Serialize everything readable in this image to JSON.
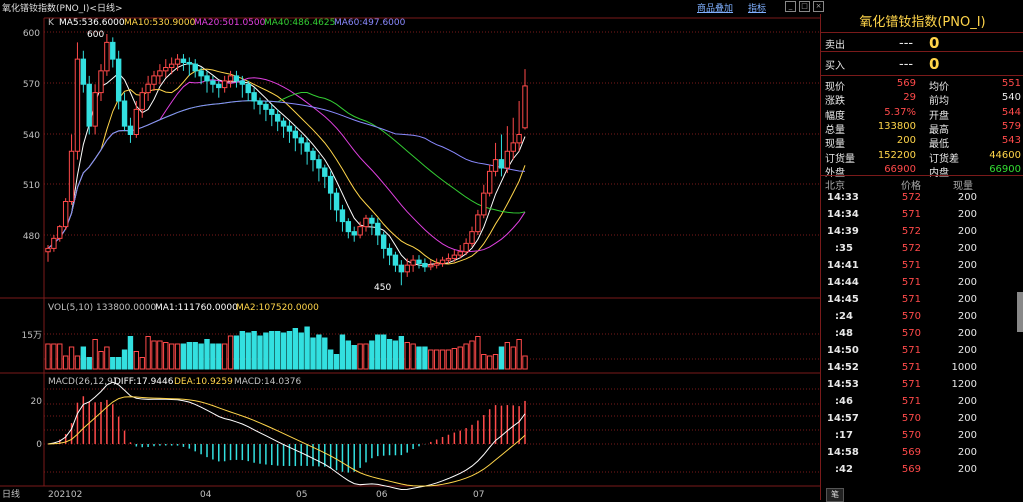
{
  "window": {
    "title": "氧化镨钕指数(PNO_I)<日线>",
    "link1": "商品叠加",
    "link2": "指标"
  },
  "kline": {
    "prefix": "K",
    "ma5": "MA5:536.6000",
    "ma10": "MA10:530.9000",
    "ma20": "MA20:501.0500",
    "ma40": "MA40:486.4625",
    "ma60": "MA60:497.6000",
    "yticks": [
      "600",
      "570",
      "540",
      "510",
      "480"
    ],
    "high_label": "600",
    "low_label": "450"
  },
  "vol": {
    "header": "VOL(5,10) 133800.0000",
    "ma1": "MA1:111760.0000",
    "ma2": "MA2:107520.0000",
    "ytick": "15万"
  },
  "macd": {
    "header": "MACD(26,12,9)",
    "diff": "DIFF:17.9446",
    "dea": "DEA:10.9259",
    "macd": "MACD:14.0376",
    "yticks": [
      "20",
      "0"
    ]
  },
  "xaxis": {
    "label": "日线",
    "ticks": [
      "202102",
      "04",
      "05",
      "06",
      "07"
    ]
  },
  "quote": {
    "title": "氧化镨钕指数(PNO_I)",
    "sell": {
      "label": "卖出",
      "price": "---",
      "qty": "0"
    },
    "buy": {
      "label": "买入",
      "price": "---",
      "qty": "0"
    },
    "stats": [
      {
        "l1": "现价",
        "v1": "569",
        "c1": "red",
        "l2": "均价",
        "v2": "551",
        "c2": "red"
      },
      {
        "l1": "涨跌",
        "v1": "29",
        "c1": "red",
        "l2": "前均",
        "v2": "540",
        "c2": "white"
      },
      {
        "l1": "幅度",
        "v1": "5.37%",
        "c1": "red",
        "l2": "开盘",
        "v2": "544",
        "c2": "red"
      },
      {
        "l1": "总量",
        "v1": "133800",
        "c1": "yellow",
        "l2": "最高",
        "v2": "579",
        "c2": "red"
      },
      {
        "l1": "现量",
        "v1": "200",
        "c1": "yellow",
        "l2": "最低",
        "v2": "543",
        "c2": "red"
      },
      {
        "l1": "订货量",
        "v1": "152200",
        "c1": "yellow",
        "l2": "订货差",
        "v2": "44600",
        "c2": "yellow"
      },
      {
        "l1": "外盘",
        "v1": "66900",
        "c1": "red",
        "l2": "内盘",
        "v2": "66900",
        "c2": "green"
      }
    ],
    "tick_headers": [
      "北京",
      "价格",
      "现量"
    ],
    "ticks": [
      {
        "t": "14:33",
        "p": "572",
        "v": "200"
      },
      {
        "t": "14:34",
        "p": "571",
        "v": "200"
      },
      {
        "t": "14:39",
        "p": "572",
        "v": "200"
      },
      {
        "t": ":35",
        "p": "572",
        "v": "200"
      },
      {
        "t": "14:41",
        "p": "571",
        "v": "200"
      },
      {
        "t": "14:44",
        "p": "571",
        "v": "200"
      },
      {
        "t": "14:45",
        "p": "571",
        "v": "200"
      },
      {
        "t": ":24",
        "p": "570",
        "v": "200"
      },
      {
        "t": ":48",
        "p": "570",
        "v": "200"
      },
      {
        "t": "14:50",
        "p": "571",
        "v": "200"
      },
      {
        "t": "14:52",
        "p": "571",
        "v": "1000"
      },
      {
        "t": "14:53",
        "p": "571",
        "v": "1200"
      },
      {
        "t": ":46",
        "p": "571",
        "v": "200"
      },
      {
        "t": "14:57",
        "p": "570",
        "v": "200"
      },
      {
        "t": ":17",
        "p": "570",
        "v": "200"
      },
      {
        "t": "14:58",
        "p": "569",
        "v": "200"
      },
      {
        "t": ":42",
        "p": "569",
        "v": "200"
      }
    ],
    "tab": "笔"
  },
  "colors": {
    "up": "#ff4a4a",
    "down": "#33e0e0",
    "ma5": "#ffffff",
    "ma10": "#ffd54a",
    "ma20": "#e040e0",
    "ma40": "#33cc33",
    "ma60": "#8a8aff",
    "grid": "#7a1a1a"
  },
  "chart_data": {
    "type": "candlestick",
    "title": "氧化镨钕指数(PNO_I)<日线>",
    "x_ticks": [
      "202102",
      "04",
      "05",
      "06",
      "07"
    ],
    "price_ylim": [
      465,
      605
    ],
    "price_yticks": [
      600,
      570,
      540,
      510,
      480
    ],
    "candles": [
      [
        470,
        472,
        464,
        474
      ],
      [
        472,
        478,
        470,
        480
      ],
      [
        478,
        485,
        476,
        486
      ],
      [
        485,
        500,
        483,
        502
      ],
      [
        500,
        530,
        498,
        540
      ],
      [
        530,
        585,
        525,
        595
      ],
      [
        585,
        570,
        565,
        590
      ],
      [
        570,
        545,
        540,
        575
      ],
      [
        545,
        565,
        540,
        570
      ],
      [
        565,
        578,
        560,
        582
      ],
      [
        578,
        595,
        575,
        600
      ],
      [
        595,
        585,
        580,
        598
      ],
      [
        585,
        560,
        555,
        590
      ],
      [
        560,
        545,
        542,
        565
      ],
      [
        545,
        540,
        535,
        550
      ],
      [
        540,
        555,
        538,
        560
      ],
      [
        555,
        565,
        550,
        568
      ],
      [
        565,
        570,
        560,
        575
      ],
      [
        570,
        575,
        566,
        578
      ],
      [
        575,
        578,
        570,
        582
      ],
      [
        578,
        580,
        574,
        585
      ],
      [
        580,
        582,
        576,
        586
      ],
      [
        582,
        585,
        578,
        588
      ],
      [
        585,
        583,
        578,
        588
      ],
      [
        583,
        582,
        575,
        586
      ],
      [
        582,
        578,
        574,
        585
      ],
      [
        578,
        575,
        570,
        580
      ],
      [
        575,
        572,
        565,
        578
      ],
      [
        572,
        570,
        565,
        575
      ],
      [
        570,
        568,
        562,
        572
      ],
      [
        568,
        572,
        565,
        575
      ],
      [
        572,
        575,
        568,
        578
      ],
      [
        575,
        572,
        568,
        578
      ],
      [
        572,
        570,
        562,
        575
      ],
      [
        570,
        565,
        560,
        572
      ],
      [
        565,
        560,
        555,
        568
      ],
      [
        560,
        558,
        552,
        562
      ],
      [
        558,
        555,
        548,
        560
      ],
      [
        555,
        552,
        545,
        558
      ],
      [
        552,
        548,
        542,
        555
      ],
      [
        548,
        545,
        538,
        550
      ],
      [
        545,
        542,
        535,
        548
      ],
      [
        542,
        538,
        530,
        545
      ],
      [
        538,
        535,
        528,
        540
      ],
      [
        535,
        530,
        522,
        538
      ],
      [
        530,
        525,
        518,
        532
      ],
      [
        525,
        520,
        512,
        528
      ],
      [
        520,
        515,
        508,
        522
      ],
      [
        515,
        505,
        495,
        518
      ],
      [
        505,
        495,
        488,
        508
      ],
      [
        495,
        488,
        482,
        498
      ],
      [
        488,
        482,
        478,
        490
      ],
      [
        482,
        480,
        476,
        485
      ],
      [
        480,
        485,
        478,
        488
      ],
      [
        485,
        490,
        482,
        492
      ],
      [
        490,
        487,
        480,
        492
      ],
      [
        487,
        480,
        474,
        490
      ],
      [
        480,
        472,
        466,
        482
      ],
      [
        472,
        468,
        462,
        475
      ],
      [
        468,
        462,
        458,
        470
      ],
      [
        462,
        458,
        450,
        465
      ],
      [
        458,
        462,
        455,
        466
      ],
      [
        462,
        465,
        458,
        468
      ],
      [
        465,
        463,
        460,
        468
      ],
      [
        463,
        461,
        458,
        466
      ],
      [
        461,
        462,
        459,
        465
      ],
      [
        462,
        463,
        460,
        466
      ],
      [
        463,
        465,
        461,
        467
      ],
      [
        465,
        466,
        463,
        469
      ],
      [
        466,
        468,
        464,
        471
      ],
      [
        468,
        470,
        466,
        474
      ],
      [
        470,
        475,
        468,
        478
      ],
      [
        475,
        482,
        473,
        485
      ],
      [
        482,
        492,
        480,
        495
      ],
      [
        492,
        505,
        490,
        510
      ],
      [
        505,
        518,
        503,
        522
      ],
      [
        518,
        525,
        515,
        535
      ],
      [
        525,
        520,
        515,
        540
      ],
      [
        520,
        530,
        517,
        545
      ],
      [
        530,
        535,
        525,
        550
      ],
      [
        535,
        540,
        530,
        560
      ],
      [
        544,
        569,
        543,
        579
      ]
    ],
    "volume_ticks": [
      "15万"
    ],
    "macd_yticks": [
      20,
      0
    ]
  }
}
